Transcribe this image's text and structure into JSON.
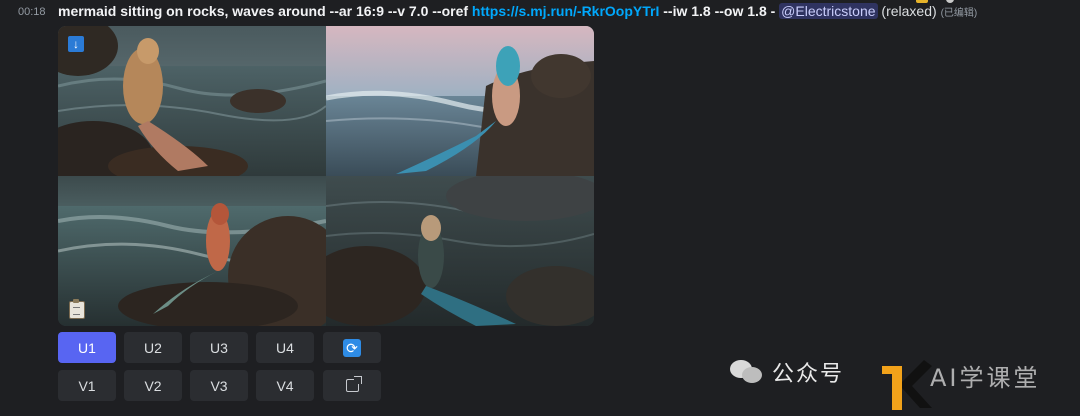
{
  "message": {
    "timestamp": "00:18",
    "prompt": "mermaid sitting on rocks, waves around",
    "params": "--ar 16:9 --v 7.0 --oref",
    "oref_link": "https://s.mj.run/-RkrOopYTrI",
    "weights": "--iw 1.8 --ow 1.8 -",
    "mention": "@Electricstone",
    "mode": "(relaxed)",
    "edited": "(已编辑)"
  },
  "image_grid": {
    "images": [
      {
        "name": "mermaid-blonde-rocks"
      },
      {
        "name": "mermaid-blue-hair-sunset"
      },
      {
        "name": "mermaid-red-hair-waves"
      },
      {
        "name": "mermaid-teal-tail-rocks"
      }
    ]
  },
  "buttons": {
    "upscale": [
      "U1",
      "U2",
      "U3",
      "U4"
    ],
    "variation": [
      "V1",
      "V2",
      "V3",
      "V4"
    ],
    "active": "U1",
    "reroll_icon": "refresh-icon",
    "open_icon": "external-link-icon"
  },
  "watermark": {
    "text1": "公众号",
    "text2": "AI学课堂"
  },
  "colors": {
    "background": "#1e1f22",
    "button": "#2b2d31",
    "button_active": "#5865f2",
    "link": "#00a8fc",
    "mention_bg": "#5865f2"
  }
}
